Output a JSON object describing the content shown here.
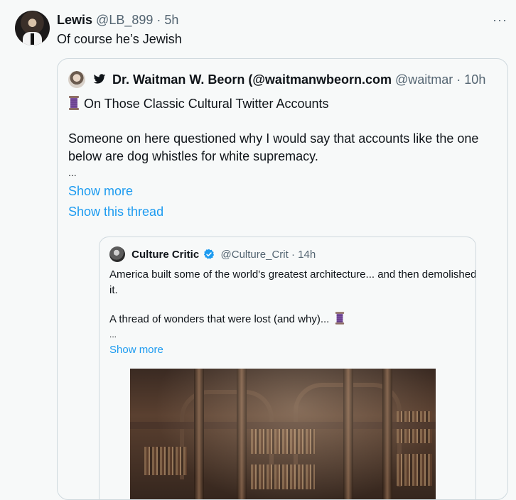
{
  "tweet": {
    "author_name": "Lewis",
    "author_handle": "@LB_899",
    "separator": "·",
    "time": "5h",
    "text": "Of course he’s Jewish",
    "more_label": "···"
  },
  "quote1": {
    "author_name": "Dr. Waitman W. Beorn (@waitmanwbeorn.com",
    "author_handle": "@waitmar",
    "separator": "·",
    "time": "10h",
    "title": "On Those Classic Cultural Twitter Accounts",
    "body": "Someone on here questioned why I would say that accounts like the one below are dog whistles for white supremacy.",
    "ellipsis": "...",
    "show_more": "Show more",
    "show_thread": "Show this thread"
  },
  "quote2": {
    "author_name": "Culture Critic",
    "author_handle": "@Culture_Crit",
    "separator": "·",
    "time": "14h",
    "text": "America built some of the world's greatest architecture... and then demolished it.",
    "thread_text": "A thread of wonders that were lost (and why)...",
    "ellipsis": "...",
    "show_more": "Show more"
  },
  "icons": {
    "more": "more-horizontal-icon",
    "bird": "twitter-bird-icon",
    "thread": "thread-spool-icon",
    "verified": "verified-badge-icon"
  },
  "colors": {
    "link": "#1d9bf0",
    "secondary_text": "#536471",
    "border": "#cfd9de",
    "thread_emoji": "#7b4fa0"
  }
}
